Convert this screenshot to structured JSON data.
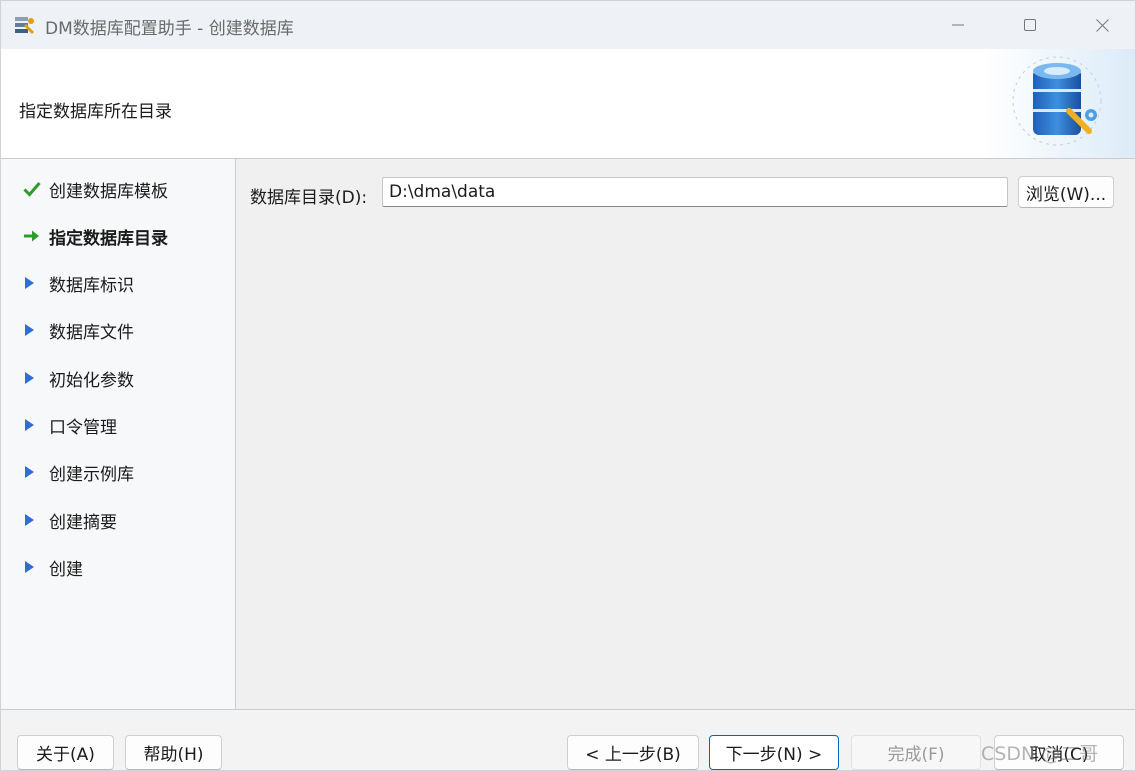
{
  "window": {
    "title": "DM数据库配置助手 - 创建数据库"
  },
  "header": {
    "title": "指定数据库所在目录"
  },
  "nav": {
    "items": [
      {
        "label": "创建数据库模板",
        "state": "done"
      },
      {
        "label": "指定数据库目录",
        "state": "current"
      },
      {
        "label": "数据库标识",
        "state": "pending"
      },
      {
        "label": "数据库文件",
        "state": "pending"
      },
      {
        "label": "初始化参数",
        "state": "pending"
      },
      {
        "label": "口令管理",
        "state": "pending"
      },
      {
        "label": "创建示例库",
        "state": "pending"
      },
      {
        "label": "创建摘要",
        "state": "pending"
      },
      {
        "label": "创建",
        "state": "pending"
      }
    ]
  },
  "main": {
    "dir_label": "数据库目录(D):",
    "dir_value": "D:\\dma\\data",
    "browse_label": "浏览(W)..."
  },
  "footer": {
    "about_label": "关于(A)",
    "help_label": "帮助(H)",
    "prev_label": "< 上一步(B)",
    "next_label": "下一步(N) >",
    "finish_label": "完成(F)",
    "cancel_label": "取消(C)"
  },
  "watermark": "CSDN @二哥",
  "colors": {
    "done_check": "#2e9a2e",
    "current_arrow": "#2e9a2e",
    "pending_triangle": "#2f6fd0",
    "primary_border": "#0067c0"
  },
  "icons": {
    "done": "check-icon",
    "current": "arrow-right-icon",
    "pending": "triangle-right-icon"
  }
}
